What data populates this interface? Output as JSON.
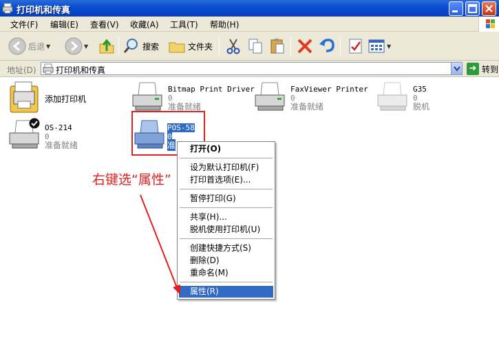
{
  "window": {
    "title": "打印机和传真"
  },
  "menubar": {
    "items": [
      {
        "label": "文件(F)"
      },
      {
        "label": "编辑(E)"
      },
      {
        "label": "查看(V)"
      },
      {
        "label": "收藏(A)"
      },
      {
        "label": "工具(T)"
      },
      {
        "label": "帮助(H)"
      }
    ]
  },
  "toolbar": {
    "back_label": "后退",
    "search_label": "搜索",
    "folders_label": "文件夹"
  },
  "address": {
    "label": "地址(D)",
    "value": "打印机和传真",
    "go_label": "转到"
  },
  "printers": [
    {
      "name": "添加打印机",
      "count": "",
      "status": ""
    },
    {
      "name": "Bitmap Print Driver",
      "count": "0",
      "status": "准备就绪"
    },
    {
      "name": "FaxViewer Printer",
      "count": "0",
      "status": "准备就绪"
    },
    {
      "name": "G35",
      "count": "0",
      "status": "脱机"
    },
    {
      "name": "OS-214",
      "count": "0",
      "status": "准备就绪"
    },
    {
      "name": "POS-58",
      "count": "0",
      "status": "准"
    }
  ],
  "context_menu": {
    "items": [
      {
        "label": "打开(O)"
      },
      {
        "label": "设为默认打印机(F)"
      },
      {
        "label": "打印首选项(E)..."
      },
      {
        "label": "暂停打印(G)"
      },
      {
        "label": "共享(H)..."
      },
      {
        "label": "脱机使用打印机(U)"
      },
      {
        "label": "创建快捷方式(S)"
      },
      {
        "label": "删除(D)"
      },
      {
        "label": "重命名(M)"
      },
      {
        "label": "属性(R)"
      }
    ]
  },
  "annotation": {
    "text": "右键选“属性”"
  },
  "colors": {
    "annotation": "#e02020",
    "selection": "#316ac5",
    "titlebar": "#0a4fd1"
  }
}
